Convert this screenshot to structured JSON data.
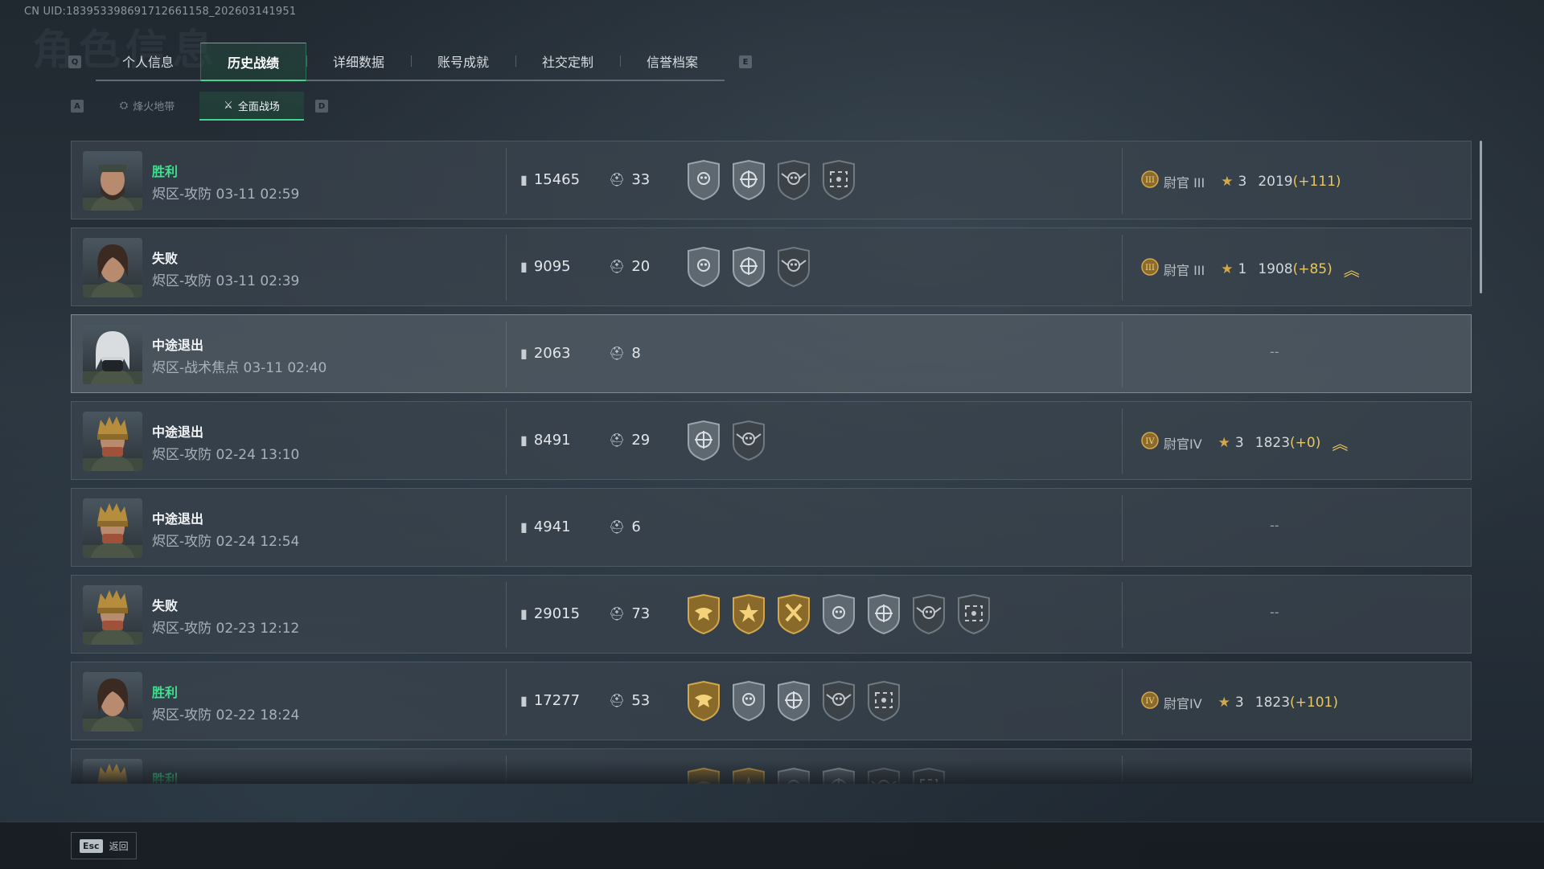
{
  "header": {
    "uid": "CN UID:183953398691712661158_202603141951",
    "watermark": "角色信息",
    "tabs_prev_key": "Q",
    "tabs_next_key": "E",
    "tabs": [
      {
        "label": "个人信息",
        "active": false
      },
      {
        "label": "历史战绩",
        "active": true
      },
      {
        "label": "详细数据",
        "active": false
      },
      {
        "label": "账号成就",
        "active": false
      },
      {
        "label": "社交定制",
        "active": false
      },
      {
        "label": "信誉档案",
        "active": false
      }
    ],
    "subtabs_prev_key": "A",
    "subtabs_next_key": "D",
    "subtabs": [
      {
        "label": "烽火地带",
        "active": false
      },
      {
        "label": "全面战场",
        "active": true
      }
    ]
  },
  "matches": [
    {
      "result": "胜利",
      "win": true,
      "mode": "烬区-攻防 03-11 02:59",
      "score": "15465",
      "kills": "33",
      "badges": [
        "silver-skull-badge",
        "silver-crosshair-badge",
        "dark-winged-skull-badge",
        "dark-scope-badge"
      ],
      "rank": "III",
      "rank_name": "尉官 III",
      "stars": "3",
      "points": "2019",
      "gain": "(+111)",
      "promo": false,
      "avatar": "bearded-soldier"
    },
    {
      "result": "失败",
      "win": false,
      "mode": "烬区-攻防 03-11 02:39",
      "score": "9095",
      "kills": "20",
      "badges": [
        "silver-skull-badge",
        "silver-crosshair-badge",
        "dark-winged-skull-badge"
      ],
      "rank": "III",
      "rank_name": "尉官 III",
      "stars": "1",
      "points": "1908",
      "gain": "(+85)",
      "promo": true,
      "avatar": "female-soldier"
    },
    {
      "result": "中途退出",
      "win": false,
      "mode": "烬区-战术焦点 03-11 02:40",
      "score": "2063",
      "kills": "8",
      "badges": [],
      "rank": "",
      "dash": "--",
      "avatar": "masked-operator",
      "highlight": true
    },
    {
      "result": "中途退出",
      "win": false,
      "mode": "烬区-攻防 02-24 13:10",
      "score": "8491",
      "kills": "29",
      "badges": [
        "silver-crosshair-badge",
        "dark-winged-skull-badge"
      ],
      "rank": "IV",
      "rank_name": "尉官IV",
      "stars": "3",
      "points": "1823",
      "gain": "(+0)",
      "promo": true,
      "avatar": "golden-helmet"
    },
    {
      "result": "中途退出",
      "win": false,
      "mode": "烬区-攻防 02-24 12:54",
      "score": "4941",
      "kills": "6",
      "badges": [],
      "rank": "",
      "dash": "--",
      "avatar": "golden-helmet"
    },
    {
      "result": "失败",
      "win": false,
      "mode": "烬区-攻防 02-23 12:12",
      "score": "29015",
      "kills": "73",
      "badges": [
        "gold-eagle-badge",
        "gold-star-badge",
        "gold-axes-badge",
        "silver-skull-badge",
        "silver-crosshair-badge",
        "dark-winged-skull-badge",
        "dark-scope-badge"
      ],
      "rank": "",
      "dash": "--",
      "avatar": "golden-helmet"
    },
    {
      "result": "胜利",
      "win": true,
      "mode": "烬区-攻防 02-22 18:24",
      "score": "17277",
      "kills": "53",
      "badges": [
        "gold-eagle-badge",
        "silver-skull-badge",
        "silver-crosshair-badge",
        "dark-winged-skull-badge",
        "dark-scope-badge"
      ],
      "rank": "IV",
      "rank_name": "尉官IV",
      "stars": "3",
      "points": "1823",
      "gain": "(+101)",
      "promo": false,
      "avatar": "female-soldier"
    },
    {
      "result": "胜利",
      "win": true,
      "mode": "",
      "score": "",
      "kills": "",
      "badges": [
        "gold-eagle-badge",
        "gold-star-badge",
        "silver-skull-badge",
        "silver-crosshair-badge",
        "dark-winged-skull-badge",
        "dark-scope-badge"
      ],
      "rank": "",
      "avatar": "golden-helmet",
      "cut": true
    }
  ],
  "footer": {
    "esc_key": "Esc",
    "back_label": "返回"
  },
  "colors": {
    "accent": "#44d48f",
    "win": "#3fe08f",
    "gain": "#e8c75a",
    "gold_badge": "#c79a3a"
  }
}
